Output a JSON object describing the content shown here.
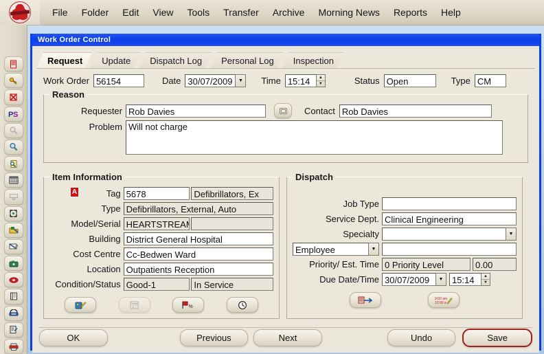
{
  "app": {
    "logo_name": "hospital-logo",
    "menu": [
      {
        "label": "File",
        "name": "menu-file"
      },
      {
        "label": "Folder",
        "name": "menu-folder"
      },
      {
        "label": "Edit",
        "name": "menu-edit"
      },
      {
        "label": "View",
        "name": "menu-view"
      },
      {
        "label": "Tools",
        "name": "menu-tools"
      },
      {
        "label": "Transfer",
        "name": "menu-transfer"
      },
      {
        "label": "Archive",
        "name": "menu-archive"
      },
      {
        "label": "Morning News",
        "name": "menu-morning-news"
      },
      {
        "label": "Reports",
        "name": "menu-reports"
      },
      {
        "label": "Help",
        "name": "menu-help"
      }
    ]
  },
  "toolbar": {
    "icons": [
      "document-red-icon",
      "key-gold-icon",
      "delete-x-icon",
      "ps-label-icon",
      "search-disabled-icon",
      "magnifier-icon",
      "find-document-icon",
      "grid-table-icon",
      "form-disabled-icon",
      "scan-document-icon",
      "flag-folder-icon",
      "edit-note-icon",
      "camera-icon",
      "tag-red-icon",
      "book-icon",
      "phone-icon",
      "checklist-edit-icon",
      "printer-icon"
    ]
  },
  "window": {
    "title": "Work Order Control"
  },
  "tabs": [
    {
      "label": "Request",
      "name": "tab-request",
      "active": true
    },
    {
      "label": "Update",
      "name": "tab-update",
      "active": false
    },
    {
      "label": "Dispatch Log",
      "name": "tab-dispatch-log",
      "active": false
    },
    {
      "label": "Personal Log",
      "name": "tab-personal-log",
      "active": false
    },
    {
      "label": "Inspection",
      "name": "tab-inspection",
      "active": false
    }
  ],
  "header": {
    "work_order_label": "Work Order",
    "work_order_value": "56154",
    "date_label": "Date",
    "date_value": "30/07/2009",
    "time_label": "Time",
    "time_value": "15:14",
    "status_label": "Status",
    "status_value": "Open",
    "type_label": "Type",
    "type_value": "CM"
  },
  "reason": {
    "title": "Reason",
    "requester_label": "Requester",
    "requester_value": "Rob Davies",
    "lookup_button_name": "requester-lookup-button",
    "contact_label": "Contact",
    "contact_value": "Rob Davies",
    "problem_label": "Problem",
    "problem_value": "Will not charge"
  },
  "item_information": {
    "title": "Item Information",
    "alert_badge": "A",
    "tag_label": "Tag",
    "tag_value": "5678",
    "tag_desc_value": "Defibrillators, Ex",
    "type_label": "Type",
    "type_value": "Defibrillators, External, Auto",
    "model_serial_label": "Model/Serial",
    "model_value": "HEARTSTREAM",
    "serial_value": "",
    "building_label": "Building",
    "building_value": "District General Hospital",
    "cost_centre_label": "Cost Centre",
    "cost_centre_value": "Cc-Bedwen Ward",
    "location_label": "Location",
    "location_value": "Outpatients Reception",
    "condition_status_label": "Condition/Status",
    "condition_value": "Good-1",
    "status_value": "In Service",
    "buttons": [
      {
        "name": "item-details-button",
        "icon": "paint-edit-icon",
        "enabled": true
      },
      {
        "name": "item-calendar-button",
        "icon": "calendar-disabled-icon",
        "enabled": false
      },
      {
        "name": "item-history-button",
        "icon": "red-flag-percent-icon",
        "enabled": true
      },
      {
        "name": "item-clock-button",
        "icon": "clock-icon",
        "enabled": true
      }
    ]
  },
  "dispatch": {
    "title": "Dispatch",
    "job_type_label": "Job Type",
    "job_type_value": "",
    "service_dept_label": "Service Dept.",
    "service_dept_value": "Clinical Engineering",
    "specialty_label": "Specialty",
    "specialty_value": "",
    "assignee_type_value": "Employee",
    "assignee_value": "",
    "priority_est_label": "Priority/ Est. Time",
    "priority_value": "0 Priority Level",
    "est_time_value": "0.00",
    "due_date_time_label": "Due Date/Time",
    "due_date_value": "30/07/2009",
    "due_time_value": "15:14",
    "buttons": [
      {
        "name": "dispatch-assign-button",
        "icon": "assign-arrow-icon"
      },
      {
        "name": "dispatch-schedule-button",
        "icon": "schedule-times-icon"
      }
    ]
  },
  "actions": {
    "ok": "OK",
    "previous": "Previous",
    "next": "Next",
    "undo": "Undo",
    "save": "Save"
  },
  "colors": {
    "window_border": "#0b3fe8",
    "title_bar": "#1b4cee",
    "form_bg": "#ece7db",
    "default_button_border": "#9e2020",
    "alert_badge": "#cc1111"
  }
}
